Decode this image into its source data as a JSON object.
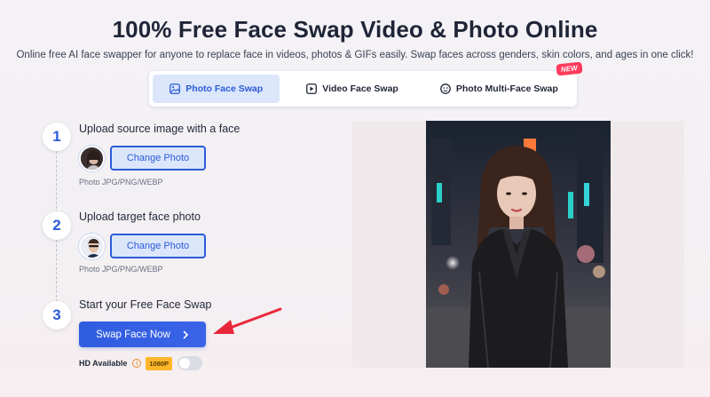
{
  "header": {
    "title": "100% Free Face Swap Video & Photo Online",
    "subtitle": "Online free AI face swapper for anyone to replace face in videos, photos & GIFs easily. Swap faces across genders, skin colors, and ages in one click!"
  },
  "tabs": [
    {
      "label": "Photo Face Swap",
      "active": true,
      "icon": "image-icon"
    },
    {
      "label": "Video Face Swap",
      "active": false,
      "icon": "video-icon"
    },
    {
      "label": "Photo Multi-Face Swap",
      "active": false,
      "icon": "multi-face-icon",
      "badge": "NEW"
    }
  ],
  "steps": [
    {
      "number": "1",
      "label": "Upload source image with a face",
      "button": "Change Photo",
      "hint": "Photo JPG/PNG/WEBP"
    },
    {
      "number": "2",
      "label": "Upload target face photo",
      "button": "Change Photo",
      "hint": "Photo JPG/PNG/WEBP"
    },
    {
      "number": "3",
      "label": "Start your Free Face Swap",
      "button": "Swap Face Now"
    }
  ],
  "hd": {
    "label": "HD Available",
    "badge": "1080P",
    "enabled": false
  },
  "colors": {
    "accent": "#2b5bd7",
    "accent_light": "#dbe6fb",
    "badge_new": "#ff3b5c",
    "hd_badge": "#ffb629",
    "arrow": "#e8283a"
  }
}
